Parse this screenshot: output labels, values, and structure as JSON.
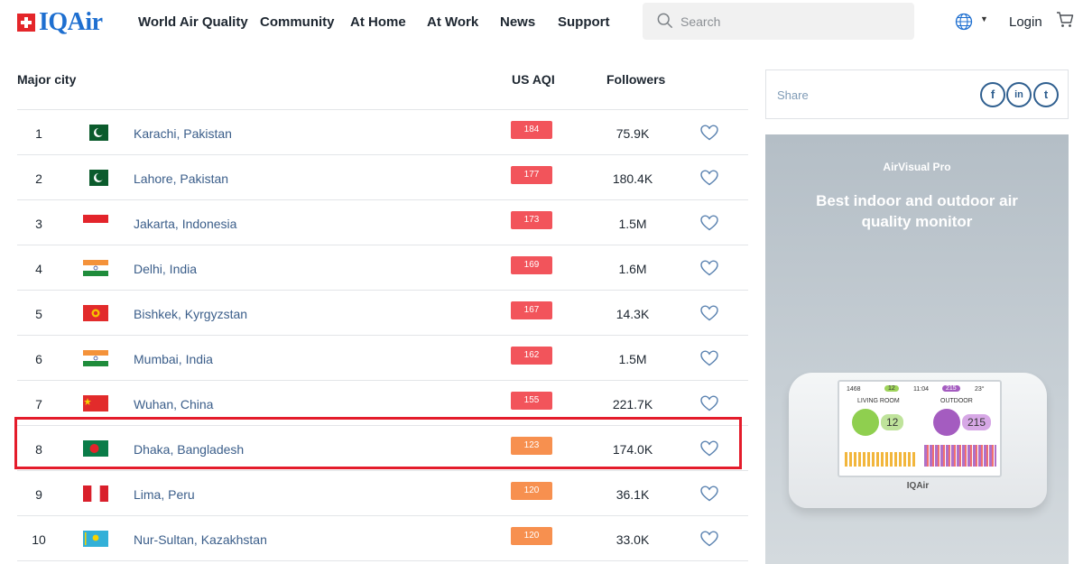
{
  "header": {
    "logo_text": "IQAir",
    "nav": [
      "World Air Quality",
      "Community",
      "At Home",
      "At Work",
      "News",
      "Support"
    ],
    "search_placeholder": "Search",
    "login_label": "Login"
  },
  "table": {
    "col_city": "Major city",
    "col_aqi": "US AQI",
    "col_followers": "Followers",
    "rows": [
      {
        "rank": "1",
        "city": "Karachi, Pakistan",
        "aqi": "184",
        "followers": "75.9K",
        "flag": "pakistan",
        "aqi_color": "#f2545b"
      },
      {
        "rank": "2",
        "city": "Lahore, Pakistan",
        "aqi": "177",
        "followers": "180.4K",
        "flag": "pakistan",
        "aqi_color": "#f2545b"
      },
      {
        "rank": "3",
        "city": "Jakarta, Indonesia",
        "aqi": "173",
        "followers": "1.5M",
        "flag": "indonesia",
        "aqi_color": "#f2545b"
      },
      {
        "rank": "4",
        "city": "Delhi, India",
        "aqi": "169",
        "followers": "1.6M",
        "flag": "india",
        "aqi_color": "#f2545b"
      },
      {
        "rank": "5",
        "city": "Bishkek, Kyrgyzstan",
        "aqi": "167",
        "followers": "14.3K",
        "flag": "kyrgyzstan",
        "aqi_color": "#f2545b"
      },
      {
        "rank": "6",
        "city": "Mumbai, India",
        "aqi": "162",
        "followers": "1.5M",
        "flag": "india",
        "aqi_color": "#f2545b"
      },
      {
        "rank": "7",
        "city": "Wuhan, China",
        "aqi": "155",
        "followers": "221.7K",
        "flag": "china",
        "aqi_color": "#f2545b"
      },
      {
        "rank": "8",
        "city": "Dhaka, Bangladesh",
        "aqi": "123",
        "followers": "174.0K",
        "flag": "bangladesh",
        "aqi_color": "#f7904f"
      },
      {
        "rank": "9",
        "city": "Lima, Peru",
        "aqi": "120",
        "followers": "36.1K",
        "flag": "peru",
        "aqi_color": "#f7904f"
      },
      {
        "rank": "10",
        "city": "Nur-Sultan, Kazakhstan",
        "aqi": "120",
        "followers": "33.0K",
        "flag": "kazakhstan",
        "aqi_color": "#f7904f"
      }
    ]
  },
  "share": {
    "label": "Share",
    "icons": [
      "f",
      "in",
      "t"
    ]
  },
  "ad": {
    "subtitle": "AirVisual Pro",
    "title": "Best indoor and outdoor air quality monitor",
    "device": {
      "stat1": "1468",
      "stat2": "12",
      "time": "11:04",
      "stat3": "215",
      "temp": "23°",
      "living_room": "LIVING ROOM",
      "outdoor": "OUTDOOR",
      "indoor_value": "12",
      "outdoor_value": "215",
      "brand": "IQAir"
    }
  },
  "colors": {
    "brand_blue": "#1e6fd0",
    "brand_red": "#e4262a",
    "highlight_red": "#e41c2b",
    "link": "#3b5e8a"
  }
}
